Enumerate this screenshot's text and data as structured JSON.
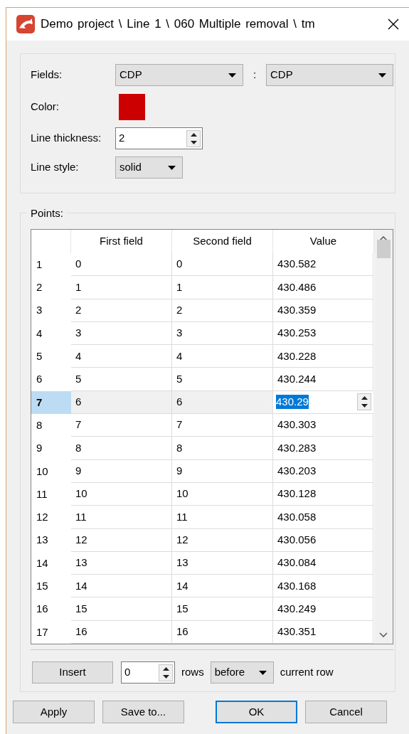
{
  "window": {
    "title": "Demo project \\ Line 1 \\ 060 Multiple removal \\ tm"
  },
  "settings": {
    "fields_label": "Fields:",
    "field_1": "CDP",
    "separator": ":",
    "field_2": "CDP",
    "color_label": "Color:",
    "color": "#cc0000",
    "thickness_label": "Line thickness:",
    "thickness": "2",
    "style_label": "Line style:",
    "style": "solid"
  },
  "points": {
    "title": "Points:",
    "columns": [
      "First field",
      "Second field",
      "Value"
    ],
    "rows": [
      {
        "header": "1",
        "first": "0",
        "second": "0",
        "value": "430.582",
        "selected": false
      },
      {
        "header": "2",
        "first": "1",
        "second": "1",
        "value": "430.486",
        "selected": false
      },
      {
        "header": "3",
        "first": "2",
        "second": "2",
        "value": "430.359",
        "selected": false
      },
      {
        "header": "4",
        "first": "3",
        "second": "3",
        "value": "430.253",
        "selected": false
      },
      {
        "header": "5",
        "first": "4",
        "second": "4",
        "value": "430.228",
        "selected": false
      },
      {
        "header": "6",
        "first": "5",
        "second": "5",
        "value": "430.244",
        "selected": false
      },
      {
        "header": "7",
        "first": "6",
        "second": "6",
        "value": "430.29",
        "selected": true
      },
      {
        "header": "8",
        "first": "7",
        "second": "7",
        "value": "430.303",
        "selected": false
      },
      {
        "header": "9",
        "first": "8",
        "second": "8",
        "value": "430.283",
        "selected": false
      },
      {
        "header": "10",
        "first": "9",
        "second": "9",
        "value": "430.203",
        "selected": false
      },
      {
        "header": "11",
        "first": "10",
        "second": "10",
        "value": "430.128",
        "selected": false
      },
      {
        "header": "12",
        "first": "11",
        "second": "11",
        "value": "430.058",
        "selected": false
      },
      {
        "header": "13",
        "first": "12",
        "second": "12",
        "value": "430.056",
        "selected": false
      },
      {
        "header": "14",
        "first": "13",
        "second": "13",
        "value": "430.084",
        "selected": false
      },
      {
        "header": "15",
        "first": "14",
        "second": "14",
        "value": "430.168",
        "selected": false
      },
      {
        "header": "16",
        "first": "15",
        "second": "15",
        "value": "430.249",
        "selected": false
      },
      {
        "header": "17",
        "first": "16",
        "second": "16",
        "value": "430.351",
        "selected": false
      }
    ],
    "insert": {
      "button": "Insert",
      "count": "0",
      "rows_label": "rows",
      "position": "before",
      "suffix": "current row"
    }
  },
  "buttons": [
    {
      "label": "Apply",
      "default": false
    },
    {
      "label": "Save to...",
      "default": false
    },
    {
      "label": "OK",
      "default": true
    },
    {
      "label": "Cancel",
      "default": false
    }
  ]
}
